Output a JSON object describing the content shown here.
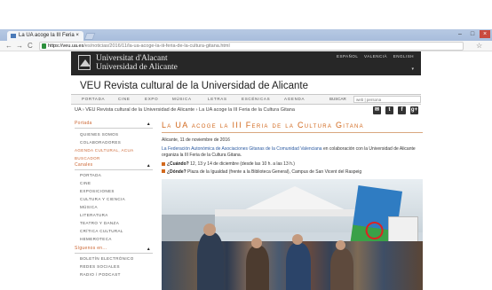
{
  "browser": {
    "tab_title": "La UA acoge la III Feria ×",
    "tab_close": "×",
    "new_tab": "",
    "window_controls": [
      "–",
      "□",
      "×"
    ],
    "nav": {
      "back": "←",
      "forward": "→",
      "reload": "C"
    },
    "url_host": "https://veu.ua.es",
    "url_path": "/es/noticias/2016/11/la-ua-acoge-la-iii-feria-de-la-cultura-gitana.html",
    "bookmark_star": "☆"
  },
  "header": {
    "university_line1": "Universitat d'Alacant",
    "university_line2": "Universidad de Alicante",
    "languages": [
      "ESPAÑOL",
      "VALENCIÀ",
      "ENGLISH"
    ],
    "expand_icon": "▾"
  },
  "site_title": "VEU Revista cultural de la Universidad de Alicante",
  "menu": {
    "items": [
      "PORTADA",
      "CINE",
      "EXPO",
      "MÚSICA",
      "LETRAS",
      "ESCÉNICAS",
      "AGENDA"
    ],
    "search_label": "BUSCAR",
    "search_placeholder": "web | persona"
  },
  "breadcrumb": "UA › VEU Revista cultural de la Universidad de Alicante › La UA acoge la III Feria de la Cultura Gitana",
  "social": [
    "✉",
    "t",
    "f",
    "g+"
  ],
  "sidebar": {
    "section1_title": "Portada",
    "section1_links": [
      "Quienes somos",
      "Colaboradores"
    ],
    "top_links": [
      "Agenda Cultural, ACUA",
      "Buscador",
      "Canales"
    ],
    "channel_links": [
      "Portada",
      "Cine",
      "Exposiciones",
      "Cultura y ciencia",
      "Música",
      "Literatura",
      "Teatro y danza",
      "Crítica cultural",
      "Hemeroteca"
    ],
    "section2_title": "Síguenos en...",
    "section2_links": [
      "Boletín electrónico",
      "Redes sociales",
      "Radio / Podcast"
    ]
  },
  "article": {
    "title": "La UA acoge la III Feria de la Cultura Gitana",
    "date": "Alicante, 11 de noviembre de 2016",
    "intro_link": "La Federación Autonómica de Asociaciones Gitanas de la Comunidad Valenciana",
    "intro_rest": " en colaboración con la Universidad de Alicante organiza la III Feria de la Cultura Gitana.",
    "when_label": "¿Cuándo?",
    "when_text": " 12, 13 y 14 de diciembre (desde las 10 h. a las 13 h.)",
    "where_label": "¿Dónde?",
    "where_text": " Plaza de la Igualdad (frente a la Biblioteca General), Campus de San Vicent del Raspeig"
  }
}
